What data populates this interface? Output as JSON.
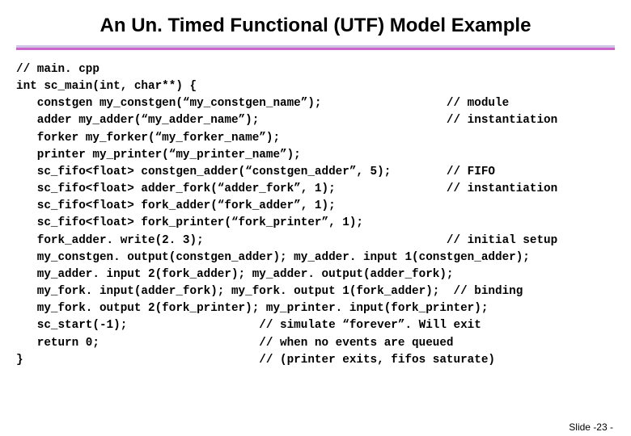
{
  "slide": {
    "title": "An Un. Timed Functional (UTF) Model Example",
    "footer": "Slide -23 -",
    "code": "// main. cpp\nint sc_main(int, char**) {\n   constgen my_constgen(“my_constgen_name”);                  // module\n   adder my_adder(“my_adder_name”);                           // instantiation\n   forker my_forker(“my_forker_name”);\n   printer my_printer(“my_printer_name”);\n   sc_fifo<float> constgen_adder(“constgen_adder”, 5);        // FIFO\n   sc_fifo<float> adder_fork(“adder_fork”, 1);                // instantiation\n   sc_fifo<float> fork_adder(“fork_adder”, 1);\n   sc_fifo<float> fork_printer(“fork_printer”, 1);\n   fork_adder. write(2. 3);                                   // initial setup\n   my_constgen. output(constgen_adder); my_adder. input 1(constgen_adder);\n   my_adder. input 2(fork_adder); my_adder. output(adder_fork);\n   my_fork. input(adder_fork); my_fork. output 1(fork_adder);  // binding\n   my_fork. output 2(fork_printer); my_printer. input(fork_printer);\n   sc_start(-1);                   // simulate “forever”. Will exit\n   return 0;                       // when no events are queued\n}                                  // (printer exits, fifos saturate)"
  }
}
